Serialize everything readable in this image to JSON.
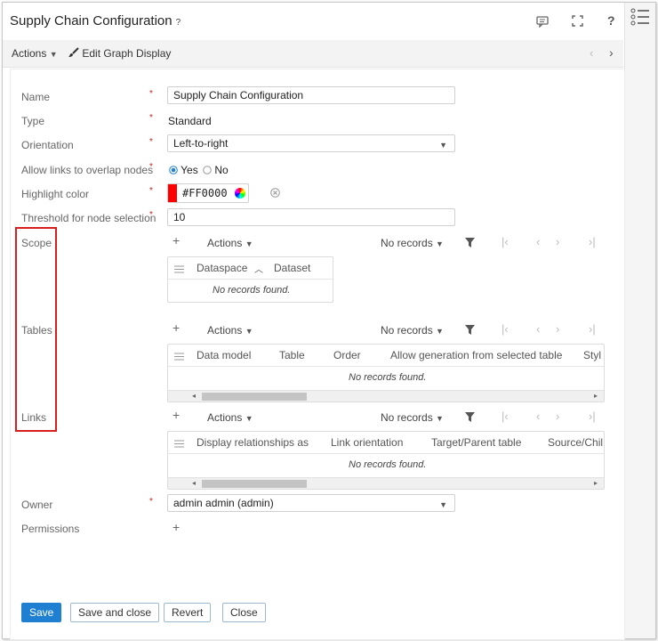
{
  "header": {
    "title": "Supply Chain Configuration",
    "help_mark": "?"
  },
  "toolbar": {
    "actions_label": "Actions",
    "edit_graph_label": "Edit Graph Display"
  },
  "form": {
    "name": {
      "label": "Name",
      "value": "Supply Chain Configuration"
    },
    "type": {
      "label": "Type",
      "value": "Standard"
    },
    "orientation": {
      "label": "Orientation",
      "value": "Left-to-right"
    },
    "overlap": {
      "label": "Allow links to overlap nodes",
      "yes": "Yes",
      "no": "No",
      "selected": "Yes"
    },
    "highlight": {
      "label": "Highlight color",
      "value": "#FF0000",
      "swatch": "#ff0000"
    },
    "threshold": {
      "label": "Threshold for node selection",
      "value": "10"
    },
    "owner": {
      "label": "Owner",
      "value": "admin admin (admin)"
    },
    "permissions": {
      "label": "Permissions"
    }
  },
  "scope": {
    "label": "Scope",
    "actions_label": "Actions",
    "records_label": "No records",
    "columns": [
      "Dataspace",
      "Dataset"
    ],
    "empty": "No records found."
  },
  "tables": {
    "label": "Tables",
    "actions_label": "Actions",
    "records_label": "No records",
    "columns": [
      "Data model",
      "Table",
      "Order",
      "Allow generation from selected table",
      "Styl"
    ],
    "empty": "No records found."
  },
  "links": {
    "label": "Links",
    "actions_label": "Actions",
    "records_label": "No records",
    "columns": [
      "Display relationships as",
      "Link orientation",
      "Target/Parent table",
      "Source/Chil"
    ],
    "empty": "No records found."
  },
  "footer": {
    "save": "Save",
    "save_close": "Save and close",
    "revert": "Revert",
    "close": "Close"
  },
  "colors": {
    "accent": "#1f7fd1",
    "highlight_box": "#d81e1e",
    "required": "#d02020"
  },
  "icons": [
    "comment-icon",
    "fullscreen-icon",
    "help-icon",
    "list-icon",
    "brush-icon",
    "filter-icon",
    "first-page-icon",
    "prev-page-icon",
    "next-page-icon",
    "last-page-icon",
    "color-wheel-icon",
    "clear-icon",
    "drag-handle-icon",
    "sort-asc-icon"
  ]
}
